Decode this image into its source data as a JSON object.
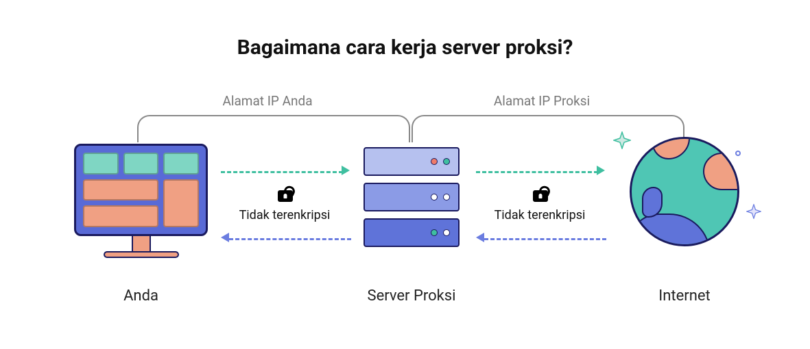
{
  "title": "Bagaimana cara kerja server proksi?",
  "ip_labels": {
    "your_ip": "Alamat IP Anda",
    "proxy_ip": "Alamat IP Proksi"
  },
  "nodes": {
    "you": "Anda",
    "proxy": "Server Proksi",
    "internet": "Internet"
  },
  "encryption": {
    "left": "Tidak terenkripsi",
    "right": "Tidak terenkripsi"
  },
  "icons": {
    "lock": "unlocked-lock-icon",
    "sparkle": "sparkle-icon",
    "monitor": "computer-monitor-icon",
    "server": "server-stack-icon",
    "globe": "globe-icon"
  },
  "colors": {
    "teal": "#3fbfa0",
    "blue": "#6b7de0",
    "navy": "#1a1a5e",
    "coral": "#f0a083",
    "mint": "#7fd6c3"
  }
}
